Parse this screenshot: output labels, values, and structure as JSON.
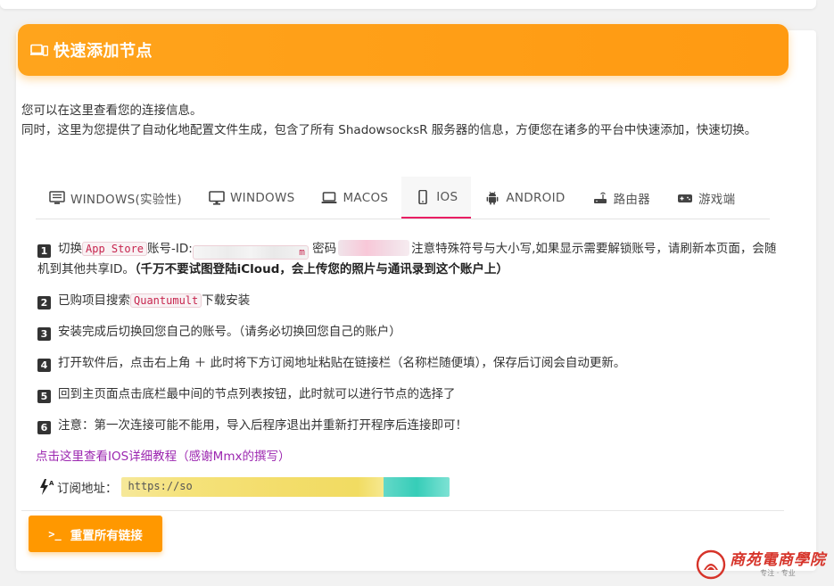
{
  "header": {
    "title": "快速添加节点",
    "accent_color": "#ff9800"
  },
  "intro": {
    "line1": "您可以在这里查看您的连接信息。",
    "line2": "同时，这里为您提供了自动化地配置文件生成，包含了所有 ShadowsocksR 服务器的信息，方便您在诸多的平台中快速添加，快速切换。"
  },
  "tabs": [
    {
      "label": "WINDOWS(实验性)",
      "icon": "windows-list-icon",
      "active": false
    },
    {
      "label": "WINDOWS",
      "icon": "monitor-icon",
      "active": false
    },
    {
      "label": "MACOS",
      "icon": "laptop-icon",
      "active": false
    },
    {
      "label": "IOS",
      "icon": "phone-icon",
      "active": true
    },
    {
      "label": "ANDROID",
      "icon": "android-icon",
      "active": false
    },
    {
      "label": "路由器",
      "icon": "router-icon",
      "active": false
    },
    {
      "label": "游戏端",
      "icon": "gamepad-icon",
      "active": false
    }
  ],
  "steps": {
    "s1": {
      "num": "1",
      "pre": "切换",
      "code": "App Store",
      "mid": "账号-ID:",
      "id_suffix": "m",
      "pw_label": "密码",
      "post": "注意特殊符号与大小写,如果显示需要解锁账号，请刷新本页面，会随机到其他共享ID。",
      "warning": "（千万不要试图登陆iCloud，会上传您的照片与通讯录到这个账户上）"
    },
    "s2": {
      "num": "2",
      "pre": "已购项目搜索",
      "code": "Quantumult",
      "post": "下载安装"
    },
    "s3": {
      "num": "3",
      "text": "安装完成后切换回您自己的账号。（请务必切换回您自己的账户）"
    },
    "s4": {
      "num": "4",
      "text": "打开软件后，点击右上角 ＋ 此时将下方订阅地址粘贴在链接栏（名称栏随便填），保存后订阅会自动更新。"
    },
    "s5": {
      "num": "5",
      "text": "回到主页面点击底栏最中间的节点列表按钮，此时就可以进行节点的选择了"
    },
    "s6": {
      "num": "6",
      "text": "注意：第一次连接可能不能用，导入后程序退出并重新打开程序后连接即可！"
    }
  },
  "tutorial_link": "点击这里查看IOS详细教程（感谢Mmx的撰写）",
  "subscription": {
    "label": "订阅地址：",
    "value": "https://so"
  },
  "reset_button": {
    "prompt": ">_",
    "label": "重置所有链接"
  },
  "logo": {
    "name": "商苑電商學院",
    "tagline": "专注 · 专业"
  }
}
